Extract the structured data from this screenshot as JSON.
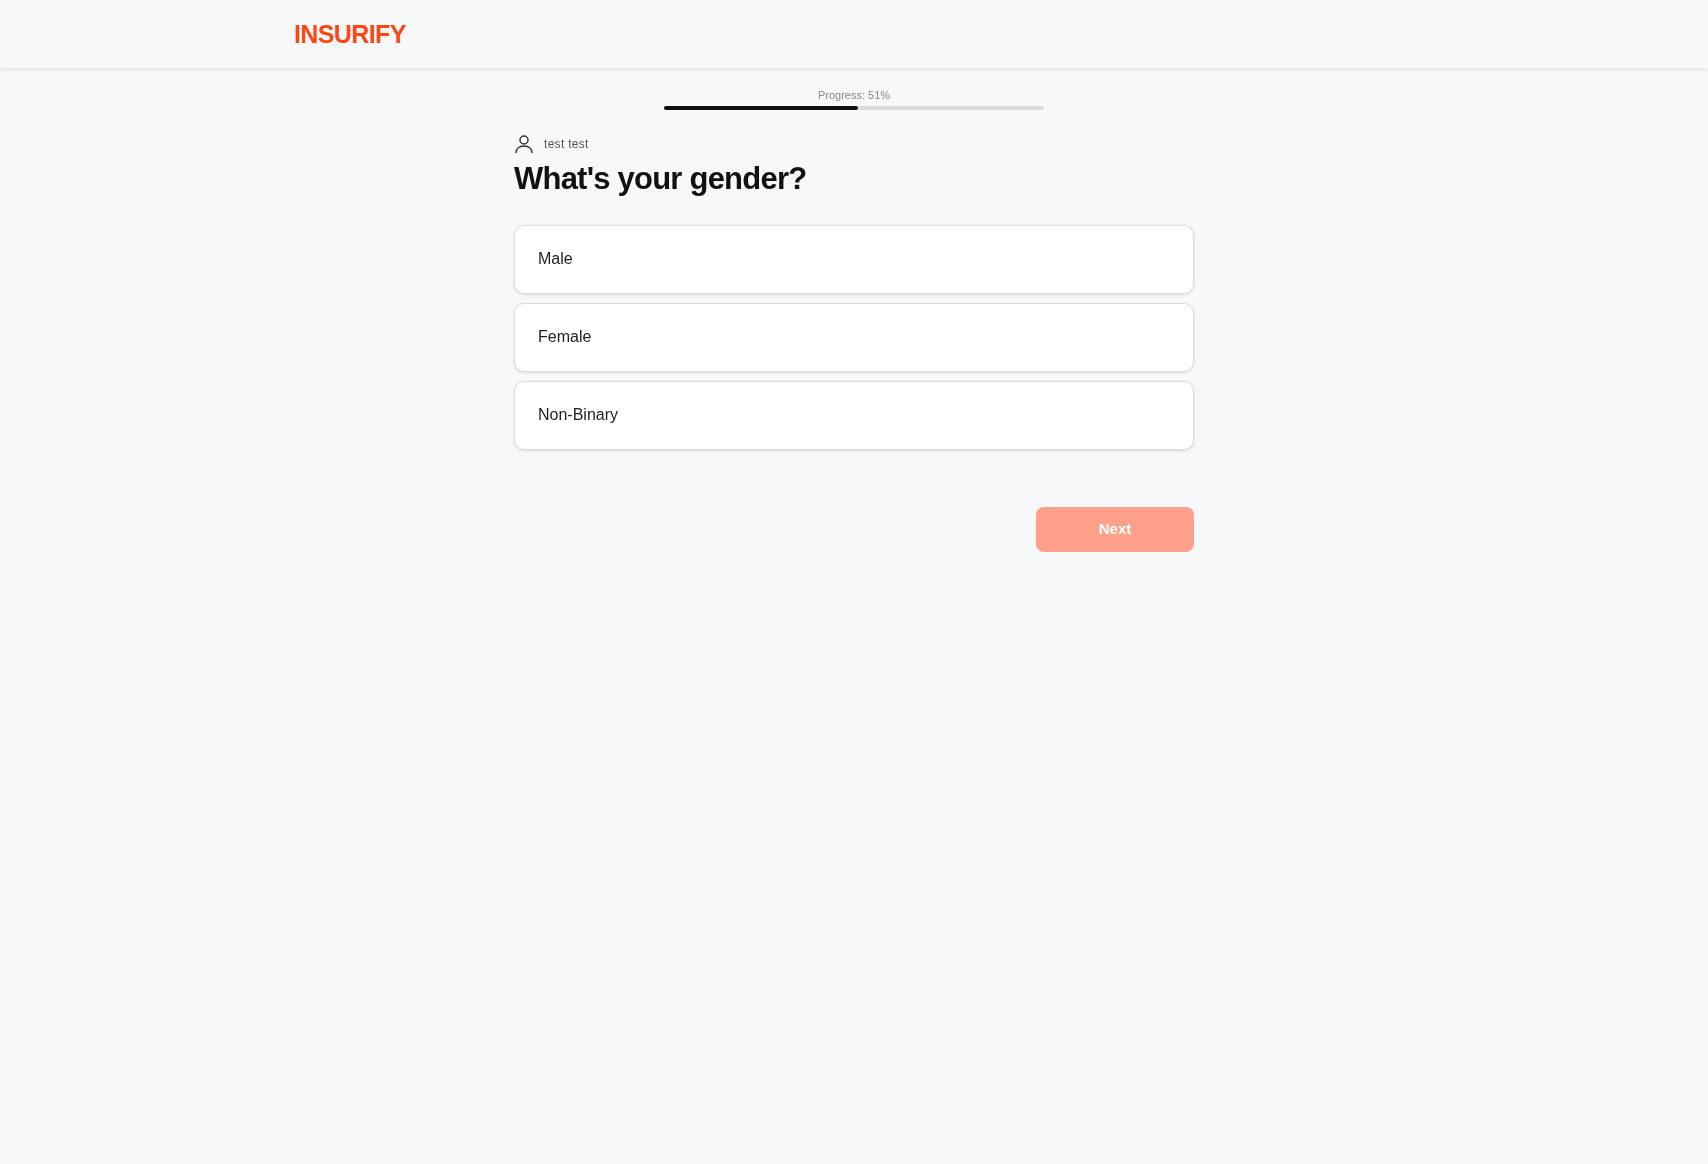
{
  "header": {
    "logo": "INSURIFY"
  },
  "progress": {
    "label": "Progress: 51%",
    "level": 0.51
  },
  "user": {
    "name": "test test"
  },
  "question": "What's your gender?",
  "options": [
    {
      "label": "Male",
      "selected": false
    },
    {
      "label": "Female",
      "selected": false
    },
    {
      "label": "Non-Binary",
      "selected": false
    }
  ],
  "next_button": {
    "label": "Next",
    "disabled": true
  }
}
